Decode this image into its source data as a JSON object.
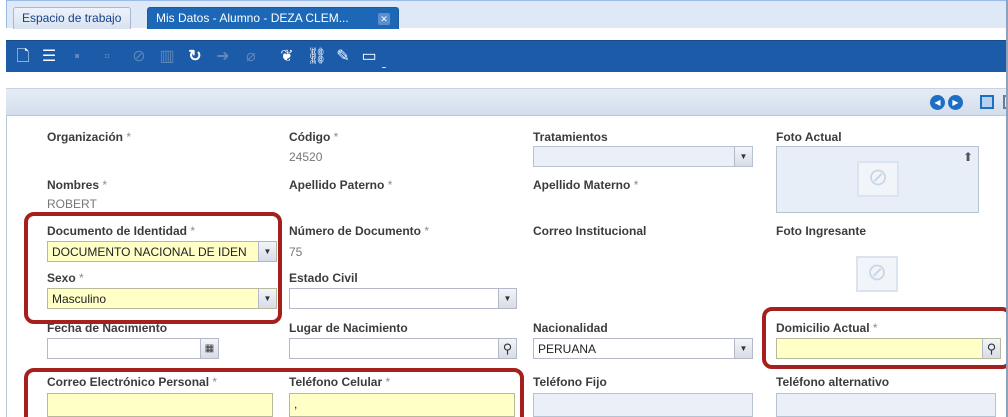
{
  "tabs": [
    {
      "label": "Espacio de trabajo",
      "active": false
    },
    {
      "label": "Mis Datos - Alumno - DEZA CLEM...",
      "active": true,
      "close_icon": "close-icon"
    }
  ],
  "toolbar": {
    "icons": [
      "new-document-icon",
      "list-icon",
      "save-icon",
      "delete-row-icon",
      "cancel-icon",
      "trash-icon",
      "refresh-icon",
      "export-icon",
      "attach-icon",
      "footprints-icon",
      "link-icon",
      "edit-form-icon",
      "panel-icon"
    ]
  },
  "navigation": {
    "icons": [
      "previous-icon",
      "next-icon",
      "maximize-icon",
      "restore-icon"
    ]
  },
  "form": {
    "required_mark": "*",
    "organizacion": {
      "label": "Organización",
      "required": true,
      "value": ""
    },
    "codigo": {
      "label": "Código",
      "required": true,
      "value": "24520"
    },
    "tratamientos": {
      "label": "Tratamientos",
      "value": ""
    },
    "foto_actual": {
      "label": "Foto Actual"
    },
    "nombres": {
      "label": "Nombres",
      "required": true,
      "value": "ROBERT"
    },
    "apellido_paterno": {
      "label": "Apellido Paterno",
      "required": true,
      "value": ""
    },
    "apellido_materno": {
      "label": "Apellido Materno",
      "required": true,
      "value": ""
    },
    "documento_identidad": {
      "label": "Documento de Identidad",
      "required": true,
      "value": "DOCUMENTO NACIONAL DE IDEN"
    },
    "numero_documento": {
      "label": "Número de Documento",
      "required": true,
      "value": "75"
    },
    "correo_institucional": {
      "label": "Correo Institucional",
      "value": ""
    },
    "foto_ingresante": {
      "label": "Foto Ingresante"
    },
    "sexo": {
      "label": "Sexo",
      "required": true,
      "value": "Masculino"
    },
    "estado_civil": {
      "label": "Estado Civil",
      "value": ""
    },
    "fecha_nacimiento": {
      "label": "Fecha de Nacimiento",
      "value": ""
    },
    "lugar_nacimiento": {
      "label": "Lugar de Nacimiento",
      "value": ""
    },
    "nacionalidad": {
      "label": "Nacionalidad",
      "value": "PERUANA"
    },
    "domicilio_actual": {
      "label": "Domicilio Actual",
      "required": true,
      "value": ""
    },
    "correo_personal": {
      "label": "Correo Electrónico Personal",
      "required": true,
      "value": ""
    },
    "telefono_celular": {
      "label": "Teléfono Celular",
      "required": true,
      "value": ","
    },
    "telefono_fijo": {
      "label": "Teléfono Fijo",
      "value": ""
    },
    "telefono_alternativo": {
      "label": "Teléfono alternativo",
      "value": ""
    }
  },
  "colors": {
    "tab_active": "#1c67b6",
    "toolbar": "#1c5ba8",
    "required_field": "#ffffc6",
    "readonly_field": "#ebf0f8",
    "highlight_box": "#a5201d"
  }
}
